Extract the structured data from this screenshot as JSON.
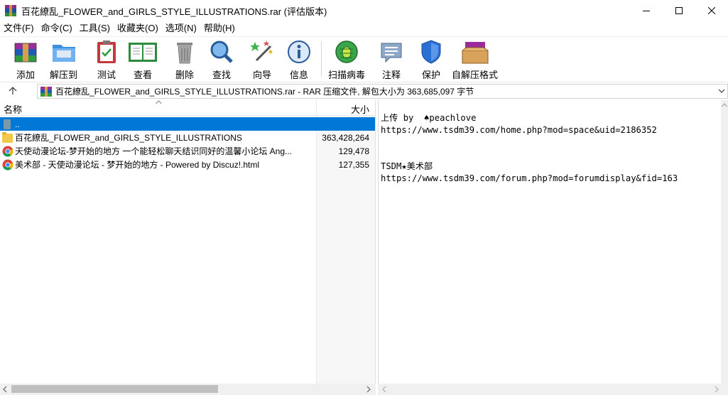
{
  "window": {
    "title": "百花繚乱_FLOWER_and_GIRLS_STYLE_ILLUSTRATIONS.rar (评估版本)"
  },
  "menu": [
    {
      "label": "文件(F)"
    },
    {
      "label": "命令(C)"
    },
    {
      "label": "工具(S)"
    },
    {
      "label": "收藏夹(O)"
    },
    {
      "label": "选项(N)"
    },
    {
      "label": "帮助(H)"
    }
  ],
  "toolbar": {
    "add": "添加",
    "extract_to": "解压到",
    "test": "测试",
    "view": "查看",
    "delete": "删除",
    "find": "查找",
    "wizard": "向导",
    "info": "信息",
    "scan": "扫描病毒",
    "comment": "注释",
    "protect": "保护",
    "sfx": "自解压格式"
  },
  "address": {
    "text": "百花繚乱_FLOWER_and_GIRLS_STYLE_ILLUSTRATIONS.rar - RAR 压缩文件, 解包大小为 363,685,097 字节"
  },
  "file_list": {
    "col_name": "名称",
    "col_size": "大小",
    "rows": [
      {
        "name": "..",
        "size": "",
        "icon": "up-folder-icon"
      },
      {
        "name": "百花繚乱_FLOWER_and_GIRLS_STYLE_ILLUSTRATIONS",
        "size": "363,428,264",
        "icon": "folder-icon"
      },
      {
        "name": "天使动漫论坛-梦开始的地方 一个能轻松聊天结识同好的温馨小论坛 Ang...",
        "size": "129,478",
        "icon": "chrome-html-icon"
      },
      {
        "name": "美术部 - 天使动漫论坛 - 梦开始的地方 - Powered by Discuz!.html",
        "size": "127,355",
        "icon": "chrome-html-icon"
      }
    ]
  },
  "comment": {
    "line1": "上传 by  ♠peachlove",
    "line2": "https://www.tsdm39.com/home.php?mod=space&uid=2186352",
    "line3": "",
    "line4": "",
    "line5": "TSDM★美术部",
    "line6": "https://www.tsdm39.com/forum.php?mod=forumdisplay&fid=163"
  },
  "colors": {
    "selection": "#0078d7",
    "accent_blue": "#1e4f9e"
  }
}
